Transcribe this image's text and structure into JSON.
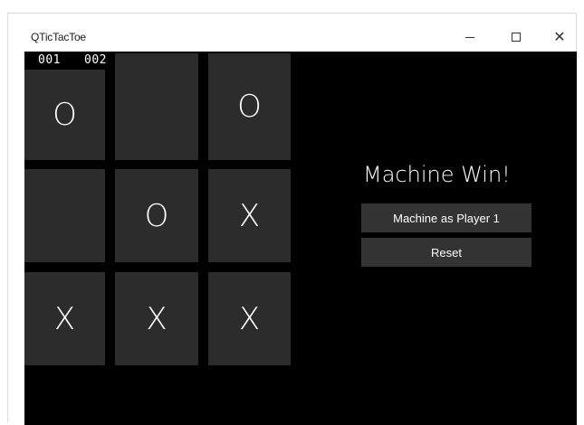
{
  "window": {
    "title": "QTicTacToe",
    "controls": {
      "minimize": "minimize",
      "maximize": "maximize",
      "close": "✕"
    }
  },
  "counters": {
    "left": "001",
    "right": "002"
  },
  "board": {
    "cells": [
      "O",
      "",
      "O",
      "",
      "O",
      "X",
      "X",
      "X",
      "X"
    ]
  },
  "status_text": "Machine Win!",
  "buttons": {
    "player_label": "Machine as Player 1",
    "reset_label": "Reset"
  },
  "colors": {
    "background": "#000000",
    "cell": "#2c2c2c",
    "button": "#333333",
    "text": "#ffffff"
  }
}
